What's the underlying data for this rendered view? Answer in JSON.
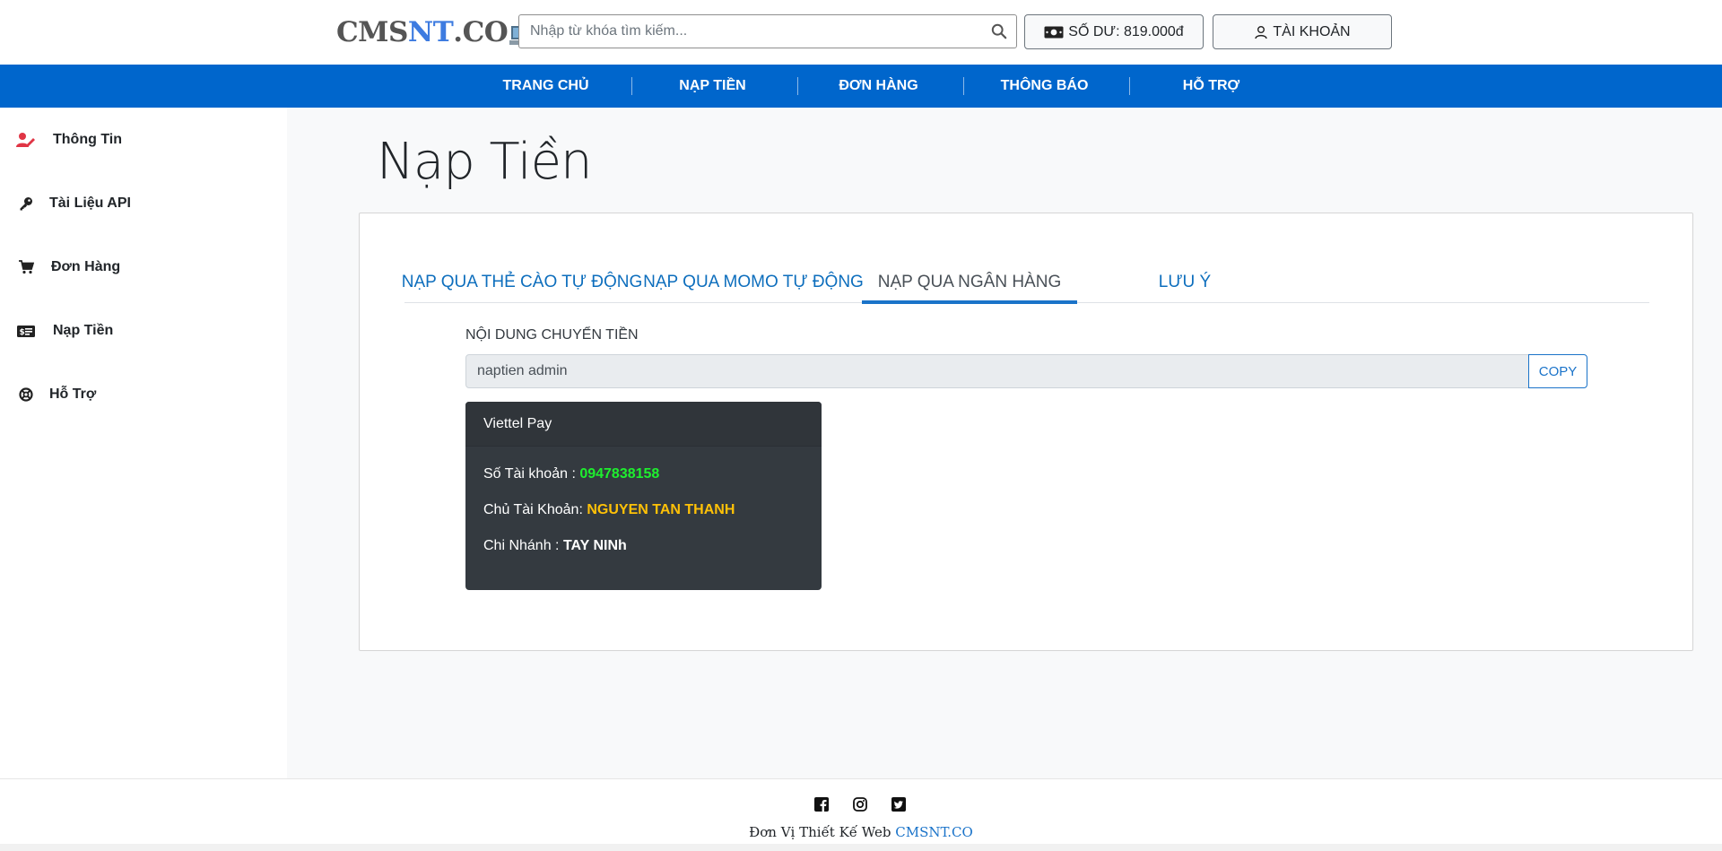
{
  "header": {
    "logo": {
      "part1": "CMS",
      "part2": "NT",
      "part3": ".CO"
    },
    "search_placeholder": "Nhập từ khóa tìm kiếm...",
    "balance_label": "SỐ DƯ: 819.000đ",
    "account_label": "TÀI KHOẢN"
  },
  "nav": {
    "items": [
      "TRANG CHỦ",
      "NẠP TIỀN",
      "ĐƠN HÀNG",
      "THÔNG BÁO",
      "HỖ TRỢ"
    ]
  },
  "sidebar": {
    "items": [
      {
        "label": "Thông Tin",
        "icon": "user-edit-icon"
      },
      {
        "label": "Tài Liệu API",
        "icon": "key-icon"
      },
      {
        "label": "Đơn Hàng",
        "icon": "cart-icon"
      },
      {
        "label": "Nạp Tiền",
        "icon": "money-bill-icon"
      },
      {
        "label": "Hỗ Trợ",
        "icon": "life-ring-icon"
      }
    ]
  },
  "main": {
    "title": "Nạp Tiền",
    "tabs": [
      "NẠP QUA THẺ CÀO TỰ ĐỘNG",
      "NẠP QUA MOMO TỰ ĐỘNG",
      "NẠP QUA NGÂN HÀNG",
      "LƯU Ý"
    ],
    "active_tab": "NẠP QUA NGÂN HÀNG",
    "transfer_label": "NỘI DUNG CHUYỂN TIỀN",
    "transfer_value": "naptien admin",
    "copy_label": "COPY",
    "bank": {
      "name": "Viettel Pay",
      "account_number_label": "Số Tài khoản : ",
      "account_number": "0947838158",
      "owner_label": "Chủ Tài Khoản: ",
      "owner": "NGUYEN TAN THANH",
      "branch_label": "Chi Nhánh : ",
      "branch": "TAY NINh"
    }
  },
  "footer": {
    "text": "Đơn Vị Thiết Kế Web ",
    "link": "CMSNT.CO",
    "social": [
      "facebook-icon",
      "instagram-icon",
      "twitter-icon"
    ]
  },
  "colors": {
    "primary": "#0066cc",
    "account_number": "#1eef2e",
    "owner": "#ffc107",
    "card_bg": "#343a40"
  }
}
